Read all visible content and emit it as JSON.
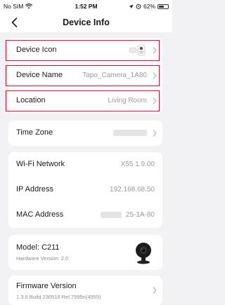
{
  "status": {
    "carrier": "No SIM",
    "time": "1:52 PM",
    "battery": "62%",
    "battery_level": 0.62
  },
  "header": {
    "title": "Device Info",
    "back_icon": "chevron-left-icon"
  },
  "device_card": {
    "icon_label": "Device Icon",
    "name_label": "Device Name",
    "name_value": "Tapo_Camera_1A80",
    "location_label": "Location",
    "location_value": "Living Room"
  },
  "timezone": {
    "label": "Time Zone"
  },
  "network": {
    "wifi_label": "Wi-Fi Network",
    "wifi_value": "X55 1.9.00",
    "ip_label": "IP Address",
    "ip_value": "192.168.68.50",
    "mac_label": "MAC Address",
    "mac_value": "25-1A-80"
  },
  "model": {
    "label": "Model: C211",
    "hardware": "Hardware Version: 2.0"
  },
  "firmware": {
    "label": "Firmware Version",
    "version": "1.3.6 Build 230518 Rel.7995n(4555)"
  },
  "colors": {
    "highlight": "#c8102e",
    "background": "#f2f2f4",
    "card": "#ffffff"
  }
}
